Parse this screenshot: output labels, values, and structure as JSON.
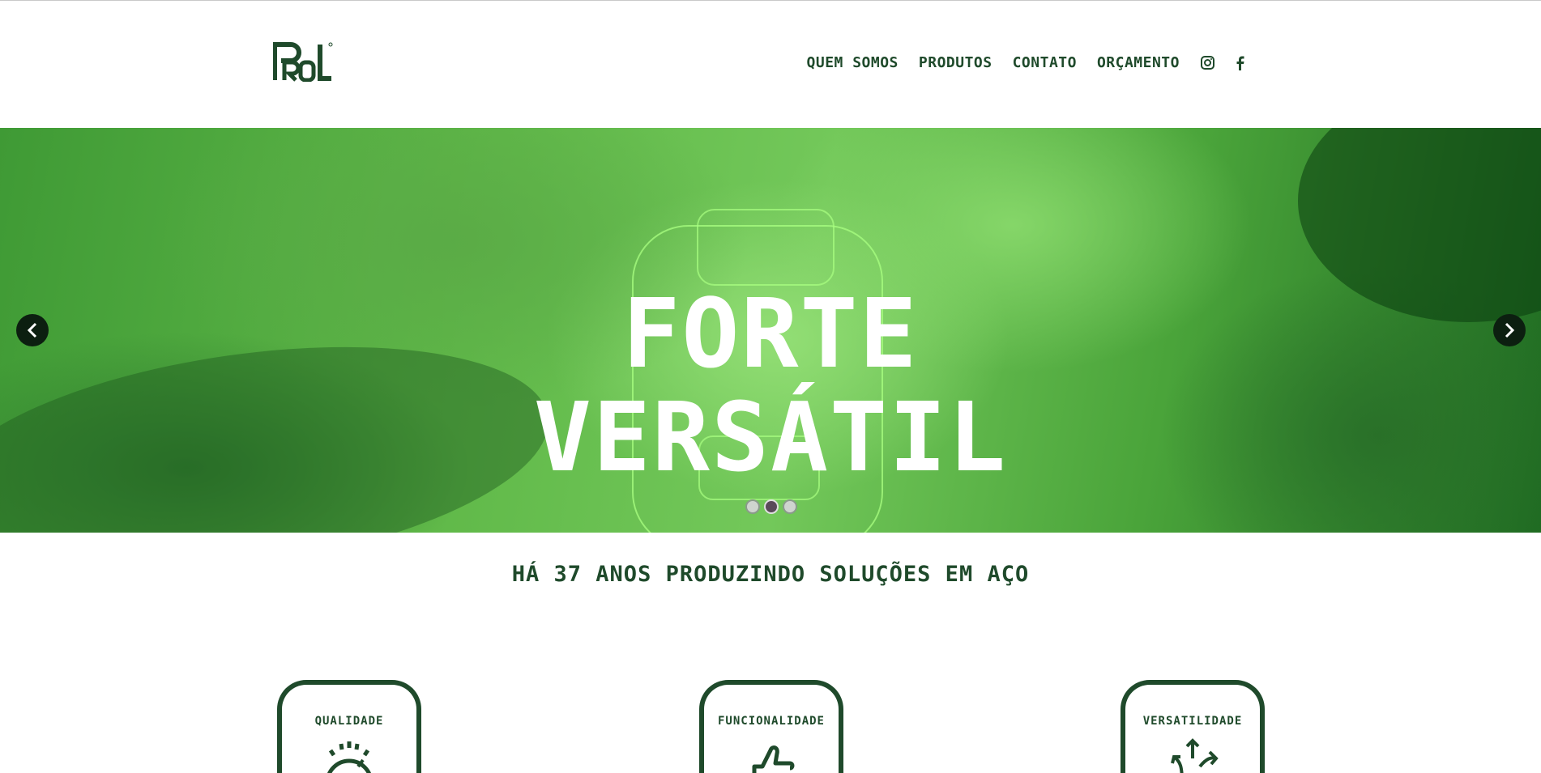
{
  "brand": {
    "logo_text": "PROL",
    "color": "#1f4a2b"
  },
  "nav": {
    "items": [
      {
        "label": "QUEM SOMOS"
      },
      {
        "label": "PRODUTOS"
      },
      {
        "label": "CONTATO"
      },
      {
        "label": "ORÇAMENTO"
      }
    ],
    "social": [
      "instagram-icon",
      "facebook-icon"
    ]
  },
  "hero": {
    "line1": "FORTE",
    "line2": "VERSÁTIL",
    "slides": 3,
    "active_slide": 2
  },
  "tagline": "HÁ 37 ANOS PRODUZINDO SOLUÇÕES EM AÇO",
  "features": [
    {
      "label": "QUALIDADE",
      "icon": "gear-check-icon"
    },
    {
      "label": "FUNCIONALIDADE",
      "icon": "thumbs-up-icon"
    },
    {
      "label": "VERSATILIDADE",
      "icon": "arrows-icon"
    }
  ]
}
